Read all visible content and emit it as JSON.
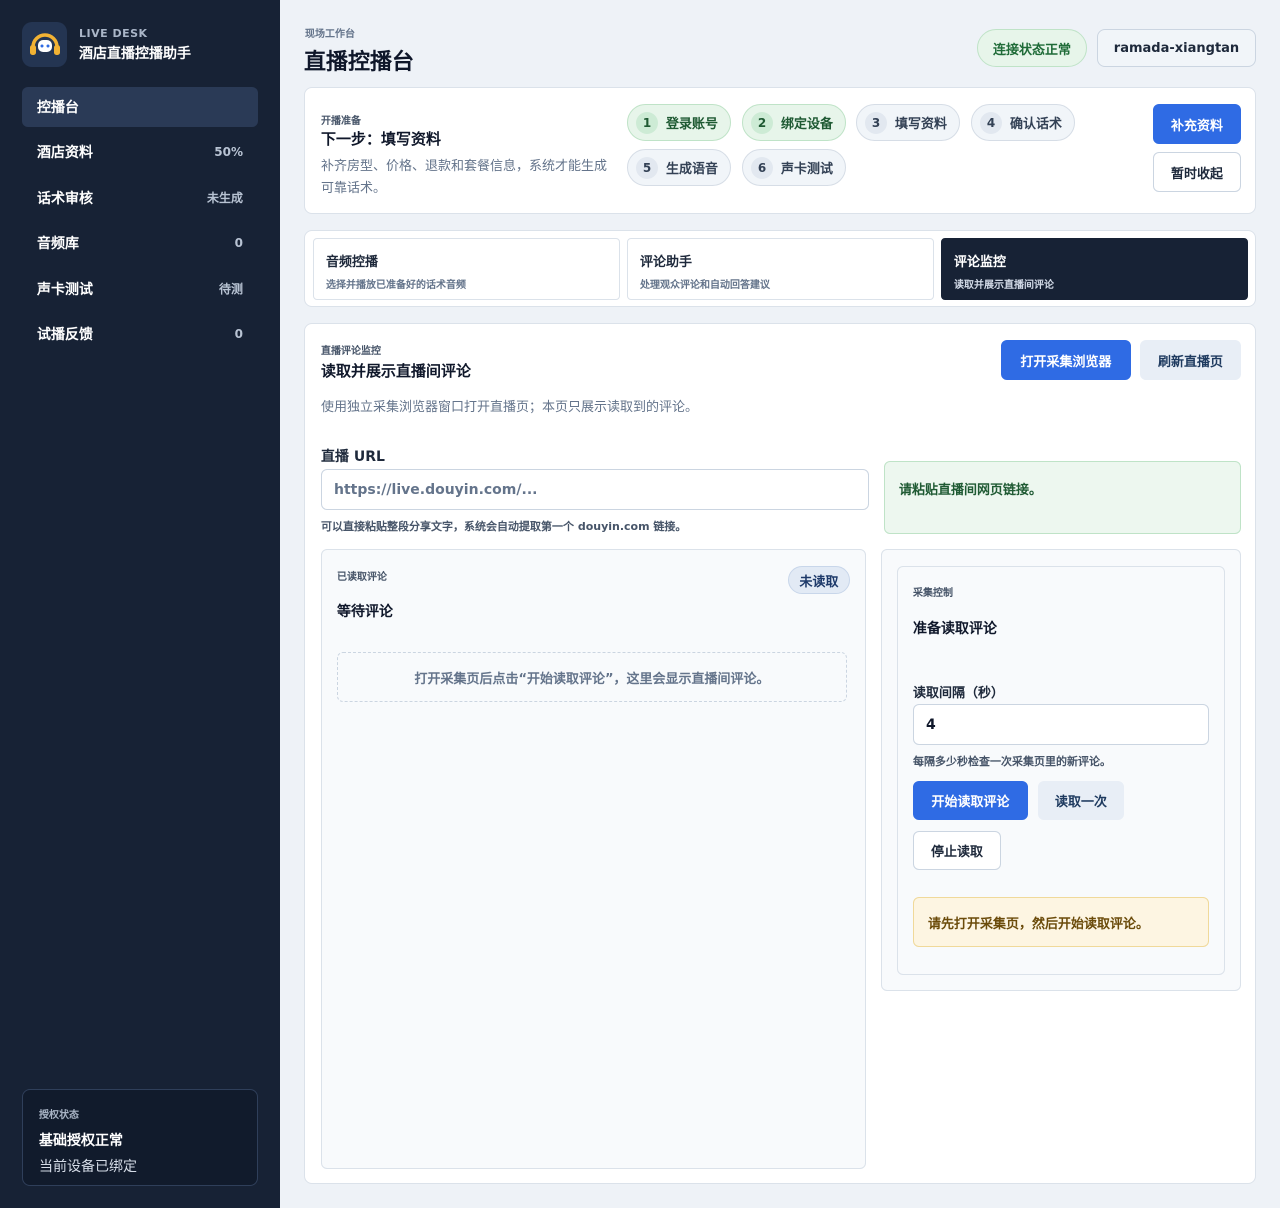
{
  "brand": {
    "kicker": "LIVE DESK",
    "title": "酒店直播控播助手",
    "logo_icon": "headset-chat-icon"
  },
  "nav": [
    {
      "label": "控播台",
      "badge": "",
      "active": true
    },
    {
      "label": "酒店资料",
      "badge": "50%"
    },
    {
      "label": "话术审核",
      "badge": "未生成"
    },
    {
      "label": "音频库",
      "badge": "0"
    },
    {
      "label": "声卡测试",
      "badge": "待测"
    },
    {
      "label": "试播反馈",
      "badge": "0"
    }
  ],
  "license": {
    "kicker": "授权状态",
    "status": "基础授权正常",
    "sub": "当前设备已绑定"
  },
  "header": {
    "kicker": "现场工作台",
    "title": "直播控播台",
    "connection": "连接状态正常",
    "user": "ramada-xiangtan"
  },
  "setup": {
    "kicker": "开播准备",
    "title": "下一步：填写资料",
    "desc": "补齐房型、价格、退款和套餐信息，系统才能生成可靠话术。",
    "steps": [
      {
        "num": "1",
        "label": "登录账号",
        "done": true
      },
      {
        "num": "2",
        "label": "绑定设备",
        "done": true
      },
      {
        "num": "3",
        "label": "填写资料",
        "done": false
      },
      {
        "num": "4",
        "label": "确认话术",
        "done": false
      },
      {
        "num": "5",
        "label": "生成语音",
        "done": false
      },
      {
        "num": "6",
        "label": "声卡测试",
        "done": false
      }
    ],
    "primary_btn": "补充资料",
    "secondary_btn": "暂时收起"
  },
  "tabs": [
    {
      "title": "音频控播",
      "sub": "选择并播放已准备好的话术音频"
    },
    {
      "title": "评论助手",
      "sub": "处理观众评论和自动回答建议"
    },
    {
      "title": "评论监控",
      "sub": "读取并展示直播间评论",
      "active": true
    }
  ],
  "main": {
    "kicker": "直播评论监控",
    "title": "读取并展示直播间评论",
    "desc": "使用独立采集浏览器窗口打开直播页；本页只展示读取到的评论。",
    "open_btn": "打开采集浏览器",
    "refresh_btn": "刷新直播页",
    "url_label": "直播 URL",
    "url_placeholder": "https://live.douyin.com/...",
    "url_hint": "可以直接粘贴整段分享文字，系统会自动提取第一个 douyin.com 链接。",
    "url_notice": "请粘贴直播间网页链接。"
  },
  "comments": {
    "kicker": "已读取评论",
    "badge": "未读取",
    "title": "等待评论",
    "empty": "打开采集页后点击“开始读取评论”，这里会显示直播间评论。"
  },
  "control": {
    "kicker": "采集控制",
    "title": "准备读取评论",
    "interval_label": "读取间隔（秒）",
    "interval_value": "4",
    "interval_hint": "每隔多少秒检查一次采集页里的新评论。",
    "start_btn": "开始读取评论",
    "once_btn": "读取一次",
    "stop_btn": "停止读取",
    "warning": "请先打开采集页，然后开始读取评论。"
  },
  "colors": {
    "sidebar": "#172235",
    "primary": "#2f6be4",
    "success_bg": "#e7f5ea",
    "warning_bg": "#fdf5e2"
  }
}
